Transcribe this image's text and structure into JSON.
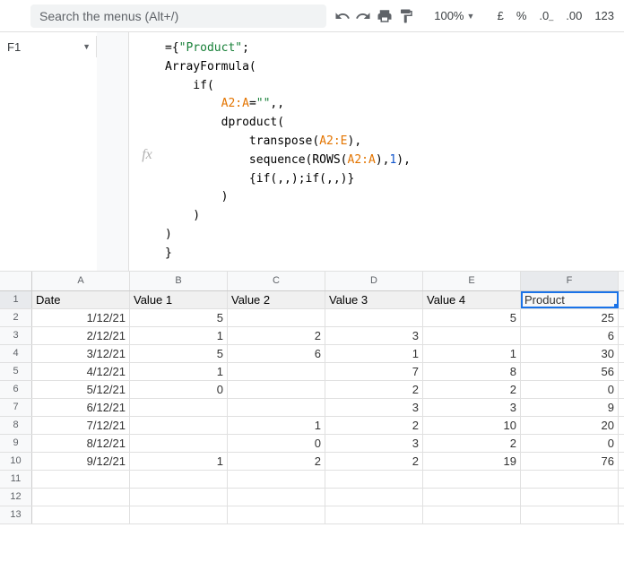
{
  "toolbar": {
    "search_placeholder": "Search the menus (Alt+/)",
    "zoom": "100%",
    "currency": "£",
    "percent": "%",
    "dec_dec": ".0",
    "dec_inc": ".00",
    "numfmt": "123"
  },
  "namebox": {
    "value": "F1"
  },
  "formula": {
    "raw": "={\"Product\";\nArrayFormula(\n    if(\n        A2:A=\"\",,\n        dproduct(\n            transpose(A2:E),\n            sequence(ROWS(A2:A),1),\n            {if(,,);if(,,)}\n        )\n    )\n)\n}"
  },
  "columns": [
    "A",
    "B",
    "C",
    "D",
    "E",
    "F"
  ],
  "active_col_index": 5,
  "headers": [
    "Date",
    "Value 1",
    "Value 2",
    "Value 3",
    "Value 4",
    "Product"
  ],
  "active_row": 1,
  "rows": [
    {
      "n": 1,
      "cells": [
        "Date",
        "Value 1",
        "Value 2",
        "Value 3",
        "Value 4",
        "Product"
      ],
      "type": "header"
    },
    {
      "n": 2,
      "cells": [
        "1/12/21",
        "5",
        "",
        "",
        "5",
        "25"
      ]
    },
    {
      "n": 3,
      "cells": [
        "2/12/21",
        "1",
        "2",
        "3",
        "",
        "6"
      ]
    },
    {
      "n": 4,
      "cells": [
        "3/12/21",
        "5",
        "6",
        "1",
        "1",
        "30"
      ]
    },
    {
      "n": 5,
      "cells": [
        "4/12/21",
        "1",
        "",
        "7",
        "8",
        "56"
      ]
    },
    {
      "n": 6,
      "cells": [
        "5/12/21",
        "0",
        "",
        "2",
        "2",
        "0"
      ]
    },
    {
      "n": 7,
      "cells": [
        "6/12/21",
        "",
        "",
        "3",
        "3",
        "9"
      ]
    },
    {
      "n": 8,
      "cells": [
        "7/12/21",
        "",
        "1",
        "2",
        "10",
        "20"
      ]
    },
    {
      "n": 9,
      "cells": [
        "8/12/21",
        "",
        "0",
        "3",
        "2",
        "0"
      ]
    },
    {
      "n": 10,
      "cells": [
        "9/12/21",
        "1",
        "2",
        "2",
        "19",
        "76"
      ]
    },
    {
      "n": 11,
      "cells": [
        "",
        "",
        "",
        "",
        "",
        ""
      ]
    },
    {
      "n": 12,
      "cells": [
        "",
        "",
        "",
        "",
        "",
        ""
      ]
    },
    {
      "n": 13,
      "cells": [
        "",
        "",
        "",
        "",
        "",
        ""
      ]
    }
  ],
  "chart_data": {
    "type": "table",
    "title": "",
    "columns": [
      "Date",
      "Value 1",
      "Value 2",
      "Value 3",
      "Value 4",
      "Product"
    ],
    "rows": [
      [
        "1/12/21",
        5,
        null,
        null,
        5,
        25
      ],
      [
        "2/12/21",
        1,
        2,
        3,
        null,
        6
      ],
      [
        "3/12/21",
        5,
        6,
        1,
        1,
        30
      ],
      [
        "4/12/21",
        1,
        null,
        7,
        8,
        56
      ],
      [
        "5/12/21",
        0,
        null,
        2,
        2,
        0
      ],
      [
        "6/12/21",
        null,
        null,
        3,
        3,
        9
      ],
      [
        "7/12/21",
        null,
        1,
        2,
        10,
        20
      ],
      [
        "8/12/21",
        null,
        0,
        3,
        2,
        0
      ],
      [
        "9/12/21",
        1,
        2,
        2,
        19,
        76
      ]
    ]
  }
}
